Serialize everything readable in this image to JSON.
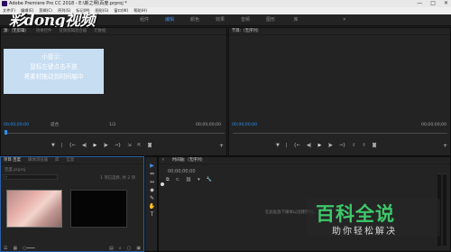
{
  "window": {
    "title": "Adobe Premiere Pro CC 2018 - E:\\新之明\\百度.prproj *",
    "controls": [
      "—",
      "□",
      "✕"
    ]
  },
  "menu": [
    "文件(F)",
    "编辑(E)",
    "剪辑(C)",
    "序列(S)",
    "标记(M)",
    "图形(G)",
    "窗口(W)",
    "帮助(H)"
  ],
  "workspace": {
    "logo": "彩dong视频",
    "tabs": [
      "组件",
      "编辑",
      "颜色",
      "效果",
      "音频",
      "图形",
      "库"
    ],
    "active_tab": "编辑",
    "more": "»"
  },
  "source_monitor": {
    "tabs": [
      "源:（无剪辑）",
      "效果控件",
      "音频剪辑混合器",
      "元数据"
    ],
    "timecode_left": "00;00;00;00",
    "timecode_right": "00;00;00;00",
    "fit_label": "适合",
    "page_label": "1/2",
    "tooltip_lines": [
      "小提示：",
      "鼠标左键点击不放",
      "将素材拖动到时间轴中"
    ]
  },
  "program_monitor": {
    "tabs": [
      "节目:（无序列）"
    ],
    "timecode_left": "00;00;00;00",
    "timecode_right": "00;00;00;00"
  },
  "project_panel": {
    "tabs": [
      "项目:百度",
      "媒体浏览器",
      "库",
      "信息"
    ],
    "file_name": "百度.prproj",
    "items_label": "1 项已选择, 共 2 项"
  },
  "timeline": {
    "tabs": [
      "时间轴:（无序列）"
    ],
    "timecode": "00;00;00;00",
    "empty_hint": "在此处放下媒体以创建序列。"
  },
  "tools": [
    "▶",
    "⇔",
    "↔",
    "◆",
    "✎",
    "✋",
    "T"
  ],
  "watermark": {
    "main": "百科全说",
    "sub": "助你轻松解决",
    "main_color": "#3ec76a"
  },
  "accent_color": "#2d8ef0"
}
